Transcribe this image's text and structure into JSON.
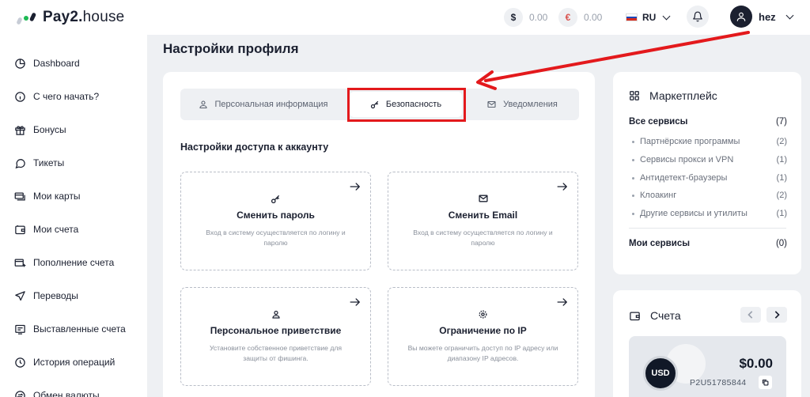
{
  "brand": {
    "name_bold": "Pay2.",
    "name_rest": "house"
  },
  "header": {
    "balances": [
      {
        "symbol": "$",
        "amount": "0.00",
        "color": "#1b2030"
      },
      {
        "symbol": "€",
        "amount": "0.00",
        "color": "#d9534f"
      }
    ],
    "language": "RU",
    "user": {
      "name": "hez"
    }
  },
  "sidebar": {
    "items": [
      {
        "label": "Dashboard",
        "icon": "pie-chart-icon"
      },
      {
        "label": "С чего начать?",
        "icon": "info-icon"
      },
      {
        "label": "Бонусы",
        "icon": "gift-icon"
      },
      {
        "label": "Тикеты",
        "icon": "chat-icon"
      },
      {
        "label": "Мои карты",
        "icon": "cards-icon"
      },
      {
        "label": "Мои счета",
        "icon": "wallet-icon"
      },
      {
        "label": "Пополнение счета",
        "icon": "deposit-icon"
      },
      {
        "label": "Переводы",
        "icon": "send-icon"
      },
      {
        "label": "Выставленные счета",
        "icon": "invoice-icon"
      },
      {
        "label": "История операций",
        "icon": "history-icon"
      },
      {
        "label": "Обмен валюты",
        "icon": "exchange-icon"
      }
    ]
  },
  "page": {
    "title": "Настройки профиля",
    "tabs": [
      {
        "label": "Персональная информация",
        "icon": "user-icon"
      },
      {
        "label": "Безопасность",
        "icon": "key-icon",
        "active": true
      },
      {
        "label": "Уведомления",
        "icon": "mail-icon"
      }
    ],
    "section_title": "Настройки доступа к аккаунту",
    "options": [
      {
        "title": "Сменить пароль",
        "desc": "Вход в систему осуществляется по логину и паролю",
        "icon": "key-icon"
      },
      {
        "title": "Сменить Email",
        "desc": "Вход в систему осуществляется по логину и паролю",
        "icon": "mail-icon"
      },
      {
        "title": "Персональное приветствие",
        "desc": "Установите собственное приветствие для защиты от фишинга.",
        "icon": "user-icon"
      },
      {
        "title": "Ограничение по IP",
        "desc": "Вы можете ограничить доступ по IP адресу или диапазону IP адресов.",
        "icon": "gear-icon"
      }
    ]
  },
  "marketplace": {
    "title": "Маркетплейс",
    "all": {
      "label": "Все сервисы",
      "count": "(7)"
    },
    "items": [
      {
        "label": "Партнёрские программы",
        "count": "(2)"
      },
      {
        "label": "Сервисы прокси и VPN",
        "count": "(1)"
      },
      {
        "label": "Антидетект-браузеры",
        "count": "(1)"
      },
      {
        "label": "Клоакинг",
        "count": "(2)"
      },
      {
        "label": "Другие сервисы и утилиты",
        "count": "(1)"
      }
    ],
    "mine": {
      "label": "Мои сервисы",
      "count": "(0)"
    }
  },
  "accounts": {
    "title": "Счета",
    "currency": "USD",
    "amount": "$0.00",
    "number": "P2U51785844"
  },
  "colors": {
    "accent": "#1b2030",
    "highlight": "#e3191c",
    "background": "#eef0f3"
  }
}
